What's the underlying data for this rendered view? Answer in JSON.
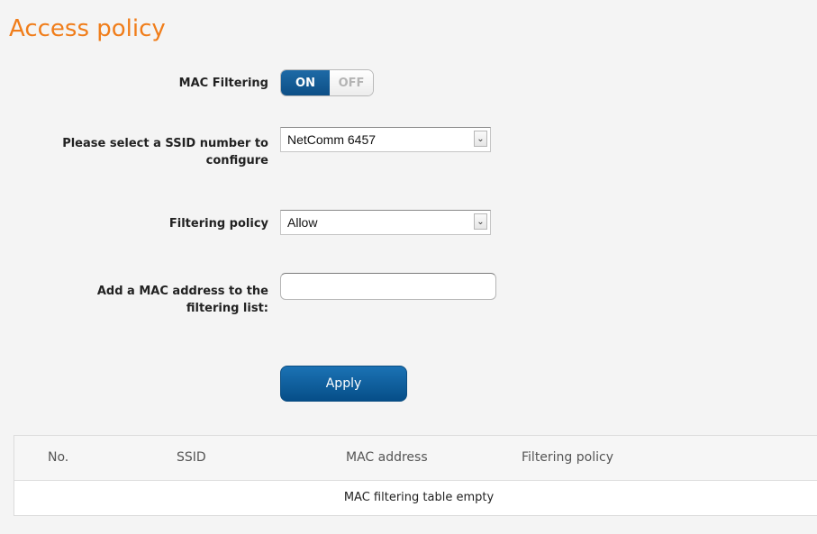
{
  "title": "Access policy",
  "mac_filtering": {
    "label": "MAC Filtering",
    "on_label": "ON",
    "off_label": "OFF"
  },
  "ssid": {
    "label_line1": "Please select a SSID number to",
    "label_line2": "configure",
    "value": "NetComm 6457"
  },
  "policy": {
    "label": "Filtering policy",
    "value": "Allow"
  },
  "mac_address": {
    "label_line1": "Add a MAC address to the",
    "label_line2": "filtering list:",
    "value": ""
  },
  "apply_label": "Apply",
  "table": {
    "columns": [
      "No.",
      "SSID",
      "MAC address",
      "Filtering policy"
    ],
    "empty_message": "MAC filtering table empty"
  }
}
